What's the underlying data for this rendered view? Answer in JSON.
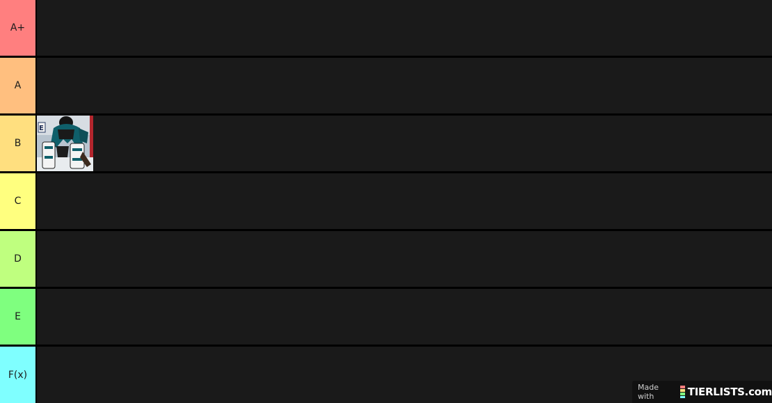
{
  "tiers": [
    {
      "label": "A+",
      "color": "#ff7f7f"
    },
    {
      "label": "A",
      "color": "#ffbf7f"
    },
    {
      "label": "B",
      "color": "#ffdf7f",
      "items": [
        {
          "image": "hockey-goalie-photo"
        }
      ]
    },
    {
      "label": "C",
      "color": "#ffff7f"
    },
    {
      "label": "D",
      "color": "#bfff7f"
    },
    {
      "label": "E",
      "color": "#7fff7f"
    },
    {
      "label": "F(x)",
      "color": "#7fffff"
    }
  ],
  "watermark": {
    "made_with": "Made with",
    "brand": "TIERLISTS.com"
  }
}
